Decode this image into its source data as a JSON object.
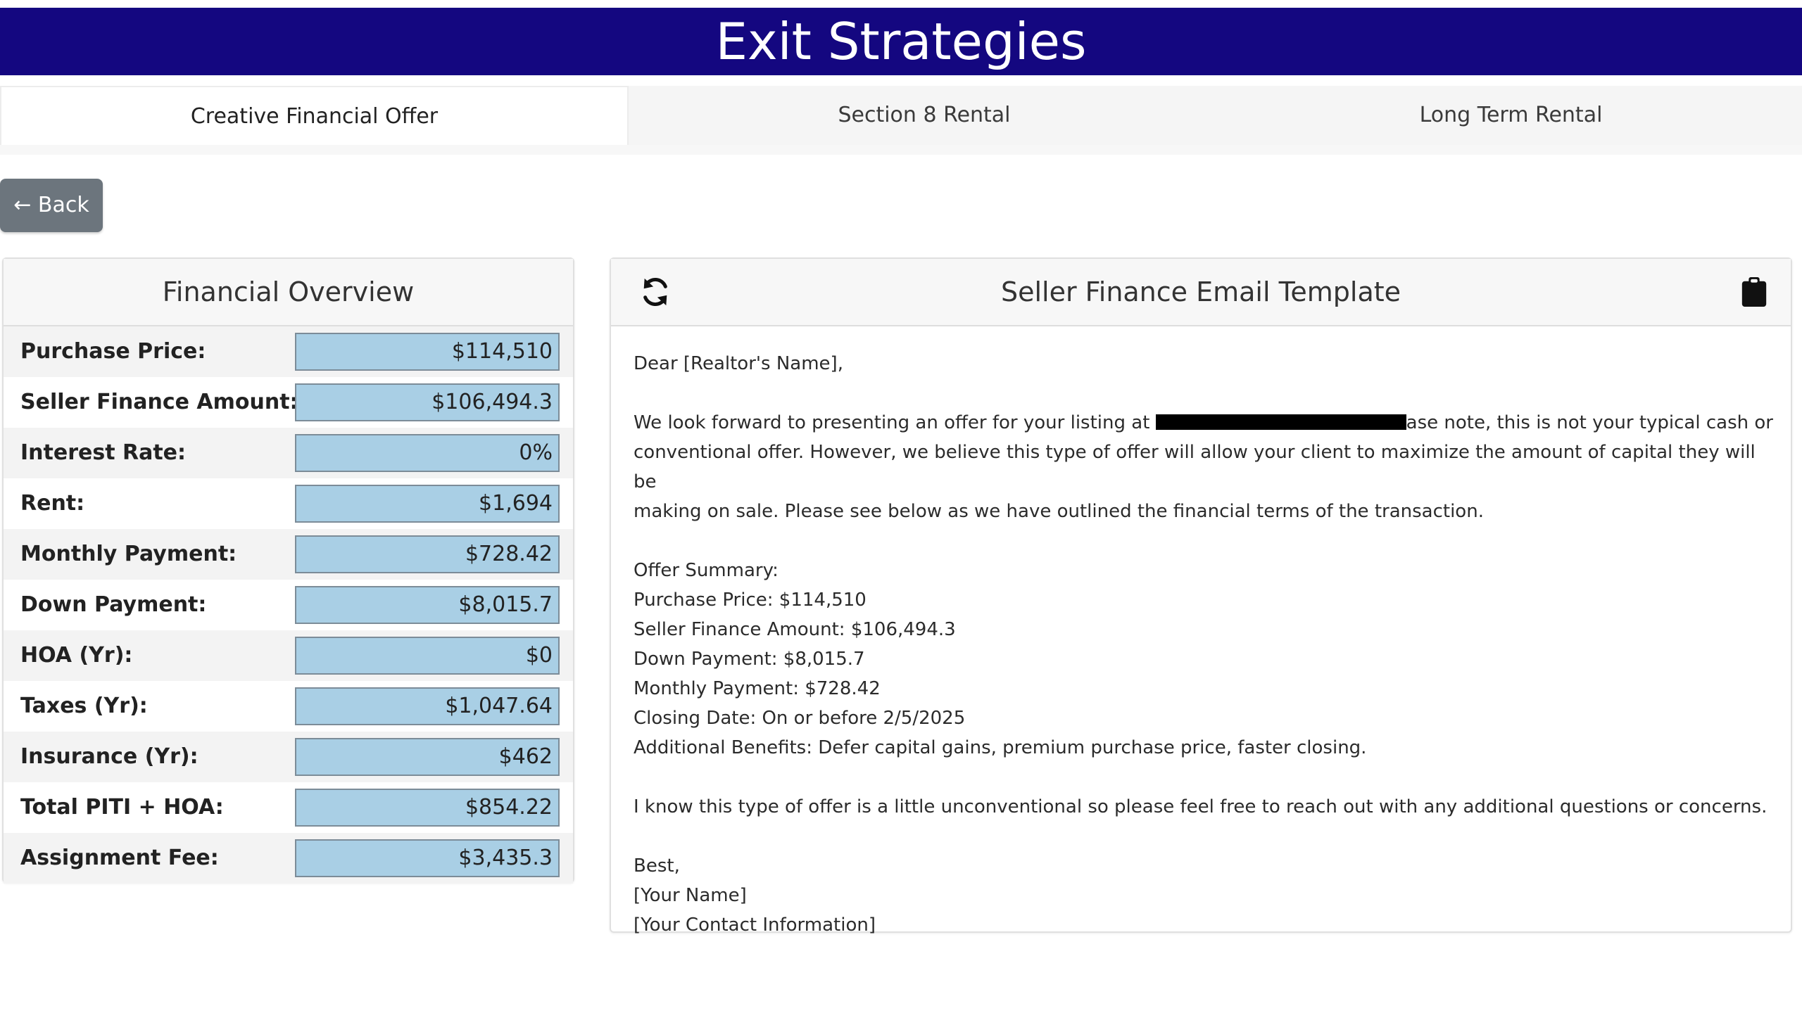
{
  "header": {
    "title": "Exit Strategies"
  },
  "tabs": [
    {
      "label": "Creative Financial Offer",
      "active": true
    },
    {
      "label": "Section 8 Rental",
      "active": false
    },
    {
      "label": "Long Term Rental",
      "active": false
    }
  ],
  "back_button": {
    "label": "← Back"
  },
  "financial_overview": {
    "title": "Financial Overview",
    "rows": [
      {
        "label": "Purchase Price:",
        "value": "$114,510"
      },
      {
        "label": "Seller Finance Amount:",
        "value": "$106,494.3"
      },
      {
        "label": "Interest Rate:",
        "value": "0%"
      },
      {
        "label": "Rent:",
        "value": "$1,694"
      },
      {
        "label": "Monthly Payment:",
        "value": "$728.42"
      },
      {
        "label": "Down Payment:",
        "value": "$8,015.7"
      },
      {
        "label": "HOA (Yr):",
        "value": "$0"
      },
      {
        "label": "Taxes (Yr):",
        "value": "$1,047.64"
      },
      {
        "label": "Insurance (Yr):",
        "value": "$462"
      },
      {
        "label": "Total PITI + HOA:",
        "value": "$854.22"
      },
      {
        "label": "Assignment Fee:",
        "value": "$3,435.3"
      }
    ]
  },
  "email_template": {
    "title": "Seller Finance Email Template",
    "refresh_icon": "refresh-icon",
    "copy_icon": "clipboard-icon",
    "greeting": "Dear [Realtor's Name],",
    "intro_part1": "We look forward to presenting an offer for your listing at",
    "intro_part2": "ase note, this is not your typical cash or",
    "intro_line2": "conventional offer. However, we believe this type of offer will allow your client to maximize the amount of capital they will be",
    "intro_line3": "making on sale. Please see below as we have outlined the financial terms of the transaction.",
    "summary_heading": "Offer Summary:",
    "summary_lines": [
      "Purchase Price: $114,510",
      "Seller Finance Amount: $106,494.3",
      "Down Payment: $8,015.7",
      "Monthly Payment: $728.42",
      "Closing Date: On or before 2/5/2025",
      "Additional Benefits: Defer capital gains, premium purchase price, faster closing."
    ],
    "closing_note": "I know this type of offer is a little unconventional so please feel free to reach out with any additional questions or concerns.",
    "sign_off": "Best,",
    "name_placeholder": "[Your Name]",
    "contact_placeholder": "[Your Contact Information]"
  }
}
